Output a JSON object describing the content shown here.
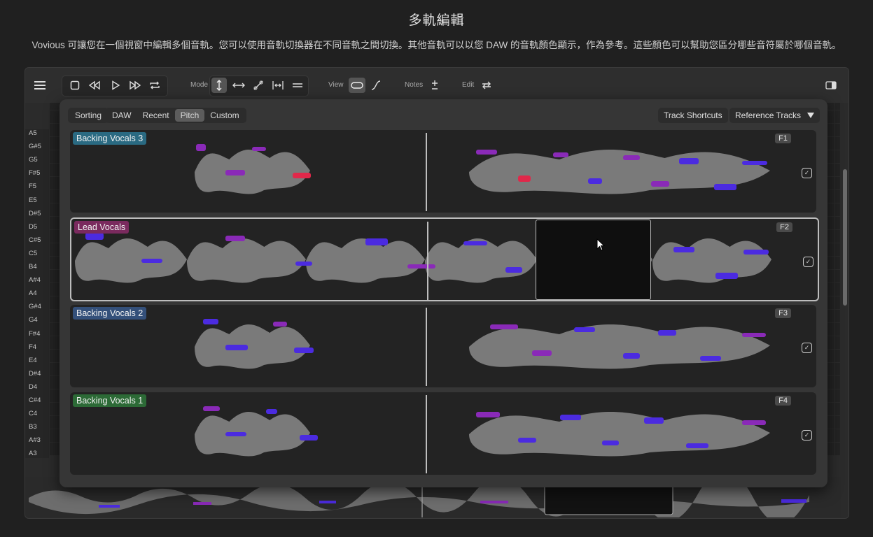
{
  "page": {
    "title": "多軌編輯",
    "description": "Vovious 可讓您在一個視窗中編輯多個音軌。您可以使用音軌切換器在不同音軌之間切換。其他音軌可以以您 DAW 的音軌顏色顯示，作為參考。這些顏色可以幫助您區分哪些音符屬於哪個音軌。"
  },
  "toolbar": {
    "mode_label": "Mode",
    "view_label": "View",
    "notes_label": "Notes",
    "edit_label": "Edit",
    "icons": [
      "menu-icon",
      "stop-icon",
      "rewind-icon",
      "play-icon",
      "fast-forward-icon",
      "loop-icon",
      "pitch-tool-icon",
      "time-tool-icon",
      "curve-tool-icon",
      "split-tool-icon",
      "merge-tool-icon",
      "blob-view-icon",
      "curve-view-icon",
      "notes-toggle-icon",
      "edit-swap-icon",
      "sidebar-icon"
    ]
  },
  "piano_keys": [
    "A5",
    "G#5",
    "G5",
    "F#5",
    "F5",
    "E5",
    "D#5",
    "D5",
    "C#5",
    "C5",
    "B4",
    "A#4",
    "A4",
    "G#4",
    "G4",
    "F#4",
    "F4",
    "E4",
    "D#4",
    "D4",
    "C#4",
    "C4",
    "B3",
    "A#3",
    "A3"
  ],
  "switcher": {
    "sorting_label": "Sorting",
    "sort_options": [
      "DAW",
      "Recent",
      "Pitch",
      "Custom"
    ],
    "sort_selected": "Pitch",
    "track_shortcuts_label": "Track Shortcuts",
    "reference_tracks_label": "Reference Tracks",
    "tracks": [
      {
        "name": "Backing Vocals 3",
        "shortcut": "F1",
        "color": "#2a6a82",
        "selected": false,
        "checked": true
      },
      {
        "name": "Lead Vocals",
        "shortcut": "F2",
        "color": "#7a2a5e",
        "selected": true,
        "checked": true
      },
      {
        "name": "Backing Vocals 2",
        "shortcut": "F3",
        "color": "#34507a",
        "selected": false,
        "checked": true
      },
      {
        "name": "Backing Vocals 1",
        "shortcut": "F4",
        "color": "#2c6a36",
        "selected": false,
        "checked": true
      }
    ]
  },
  "colors": {
    "note_blue": "#4b2be0",
    "note_purple": "#8a2ab8",
    "note_red": "#e0284a",
    "waveform": "#7a7a7a"
  }
}
